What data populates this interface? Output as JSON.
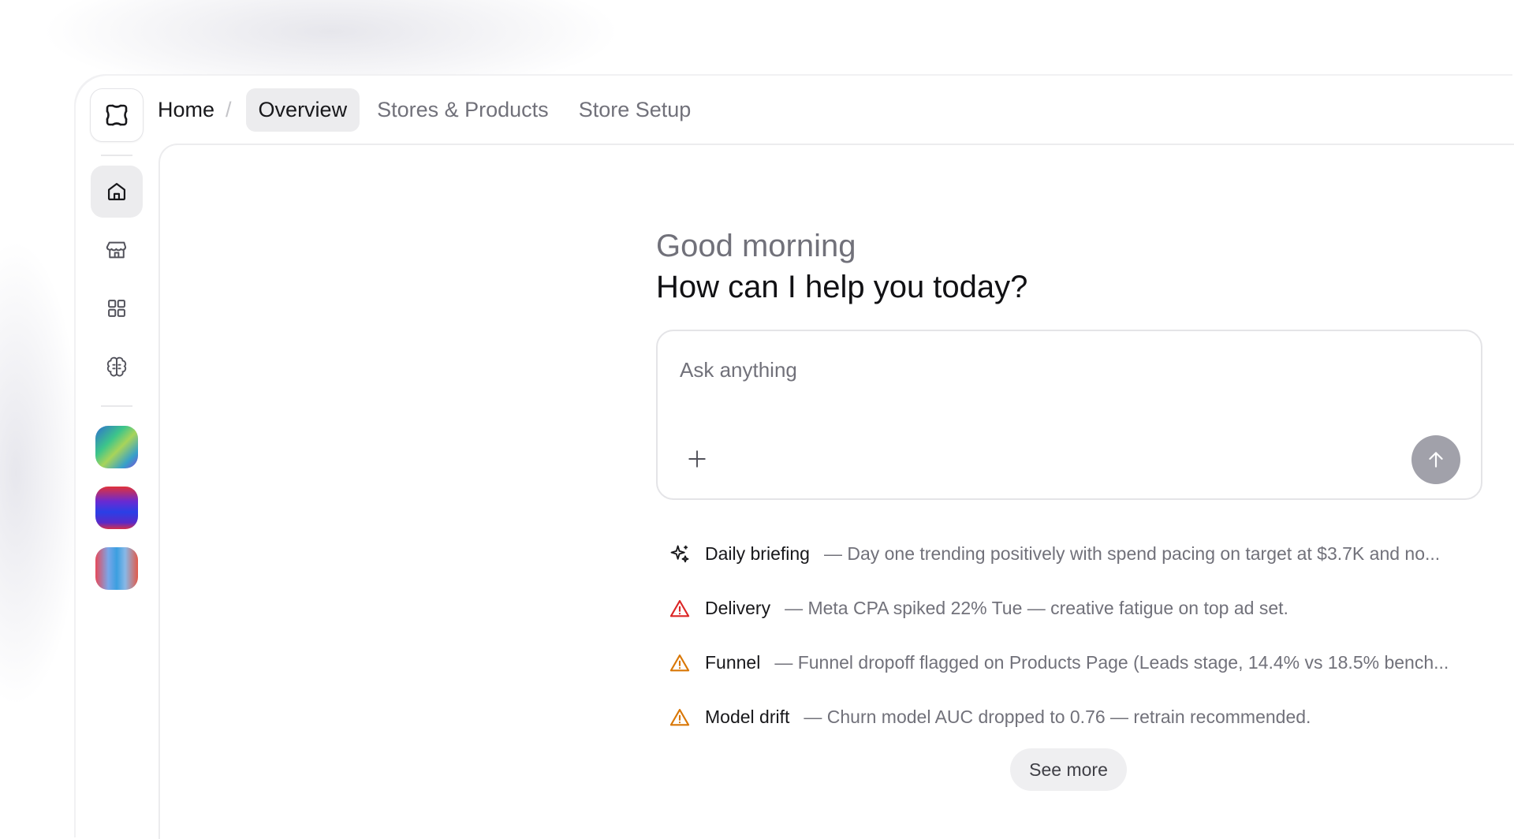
{
  "header": {
    "home": "Home",
    "separator": "/",
    "tabs": [
      {
        "label": "Overview",
        "active": true
      },
      {
        "label": "Stores & Products",
        "active": false
      },
      {
        "label": "Store Setup",
        "active": false
      }
    ]
  },
  "sidebar": {
    "logo_icon": "app-logo-icon",
    "nav": [
      {
        "icon": "home-icon",
        "active": true
      },
      {
        "icon": "store-icon",
        "active": false
      },
      {
        "icon": "grid-icon",
        "active": false
      },
      {
        "icon": "brain-icon",
        "active": false
      }
    ],
    "workspaces": [
      {
        "colors": [
          "#2e6fd1",
          "#3dc58a",
          "#7a4bd8"
        ]
      },
      {
        "colors": [
          "#e0323a",
          "#2a3fe6",
          "#d4304a"
        ]
      },
      {
        "colors": [
          "#e64a5a",
          "#3b9fe0",
          "#e25a4a"
        ]
      }
    ]
  },
  "main": {
    "greeting": "Good morning",
    "prompt": "How can I help you today?",
    "composer": {
      "placeholder": "Ask anything",
      "attach_icon": "plus-icon",
      "send_icon": "arrow-up-icon"
    },
    "alerts": [
      {
        "icon": "sparkles-icon",
        "color": "#18181b",
        "title": "Daily briefing",
        "desc": "— Day one trending positively with spend pacing on target at $3.7K and no..."
      },
      {
        "icon": "warning-icon",
        "color": "#dc2626",
        "title": "Delivery",
        "desc": "— Meta CPA spiked 22% Tue — creative fatigue on top ad set."
      },
      {
        "icon": "warning-icon",
        "color": "#d97706",
        "title": "Funnel",
        "desc": "— Funnel dropoff flagged on Products Page (Leads stage, 14.4% vs 18.5% bench..."
      },
      {
        "icon": "warning-icon",
        "color": "#d97706",
        "title": "Model drift",
        "desc": "— Churn model AUC dropped to 0.76 — retrain recommended."
      }
    ],
    "see_more": "See more"
  }
}
